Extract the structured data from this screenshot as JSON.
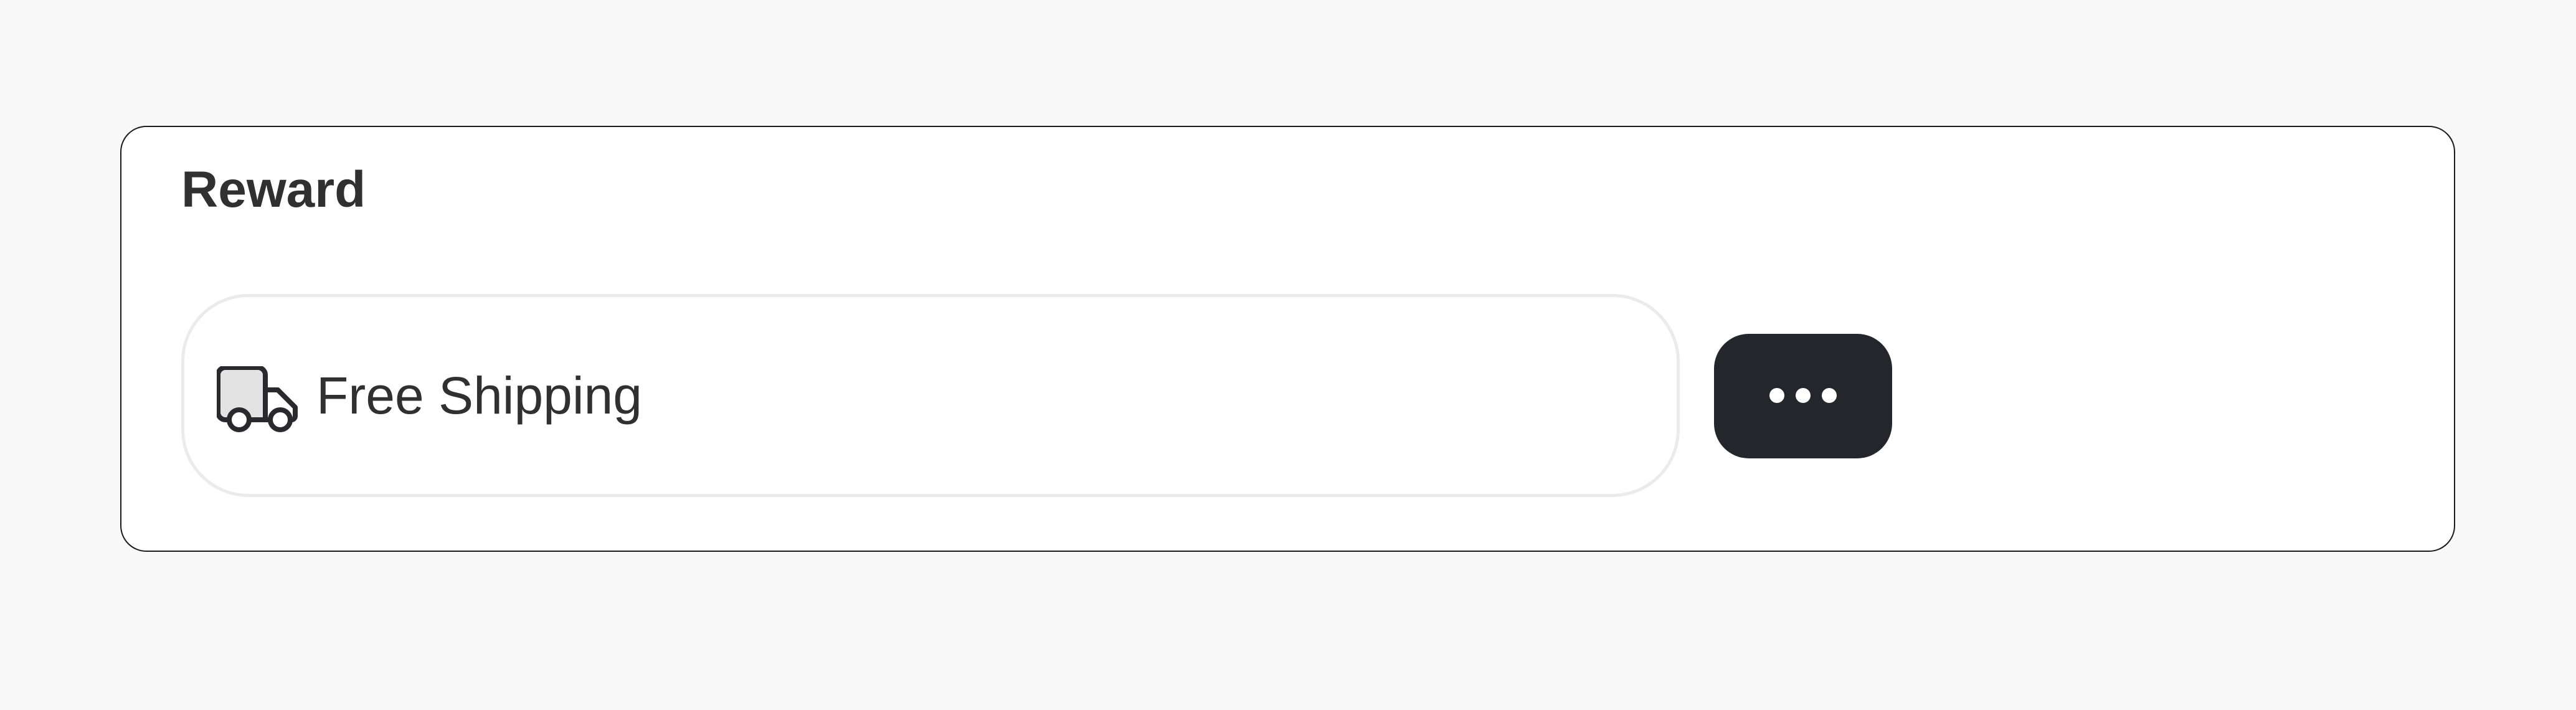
{
  "card": {
    "title": "Reward"
  },
  "reward": {
    "label": "Free Shipping",
    "icon": "truck-icon"
  },
  "more_button": {
    "icon": "ellipsis-horizontal-icon",
    "aria_label": "More actions"
  },
  "colors": {
    "background": "#f8f8f8",
    "card": "#ffffff",
    "text": "#303030",
    "button": "#25262b"
  }
}
